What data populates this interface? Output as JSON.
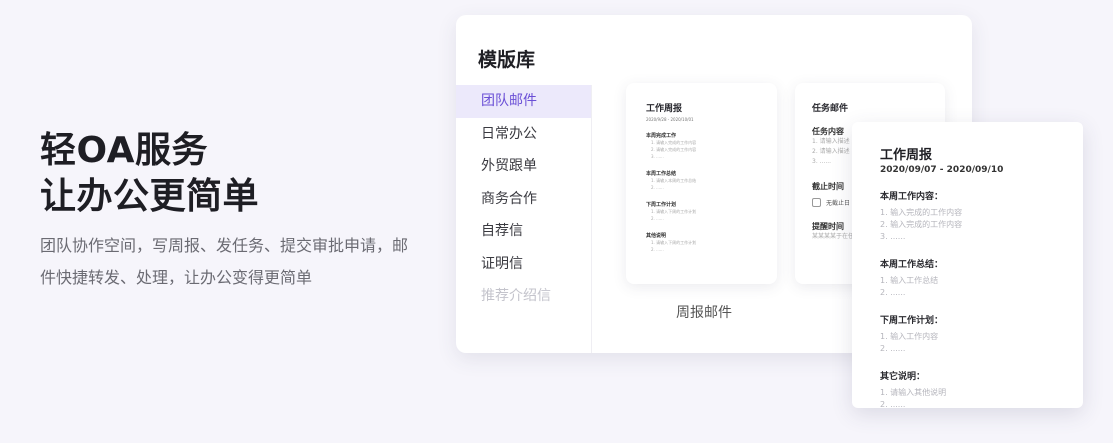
{
  "hero": {
    "title_line1": "轻OA服务",
    "title_line2": "让办公更简单",
    "desc": "团队协作空间，写周报、发任务、提交审批申请，邮件快捷转发、处理，让办公变得更简单"
  },
  "panel": {
    "title": "模版库",
    "sidebar": [
      {
        "label": "团队邮件",
        "active": true
      },
      {
        "label": "日常办公"
      },
      {
        "label": "外贸跟单"
      },
      {
        "label": "商务合作"
      },
      {
        "label": "自荐信"
      },
      {
        "label": "证明信"
      },
      {
        "label": "推荐介绍信"
      }
    ],
    "card1": {
      "title": "工作周报",
      "date": "2020/9/28 - 2020/10/01",
      "sections": [
        {
          "title": "本周完成工作",
          "lines": [
            "1. 请输入完成的工作内容",
            "2. 请输入完成的工作内容",
            "3. ......"
          ]
        },
        {
          "title": "本周工作总结",
          "lines": [
            "1. 请输入本周的工作总结",
            "2. ......"
          ]
        },
        {
          "title": "下周工作计划",
          "lines": [
            "1. 请输入下周的工作计划",
            "2. ......"
          ]
        },
        {
          "title": "其他说明",
          "lines": [
            "1. 请输入下周的工作计划",
            "2. ......"
          ]
        }
      ]
    },
    "card2": {
      "title": "任务邮件",
      "sec1": "任务内容",
      "sec1_lines": [
        "1. 请输入描述",
        "2. 请输入描述",
        "3. ......"
      ],
      "sec2": "截止时间",
      "checkbox": "无截止日",
      "sec3": "提醒时间",
      "sec3_line": "某某某某于在任务截止"
    },
    "caption": "周报邮件"
  },
  "big": {
    "title": "工作周报",
    "date": "2020/09/07 - 2020/09/10",
    "sec1": "本周工作内容：",
    "sec1_lines": [
      "1. 输入完成的工作内容",
      "2. 输入完成的工作内容",
      "3. ......"
    ],
    "sec2": "本周工作总结：",
    "sec2_lines": [
      "1. 输入工作总结",
      "2. ......"
    ],
    "sec3": "下周工作计划：",
    "sec3_lines": [
      "1. 输入工作内容",
      "2. ......"
    ],
    "sec4": "其它说明：",
    "sec4_lines": [
      "1. 请输入其他说明",
      "2. ......"
    ]
  }
}
